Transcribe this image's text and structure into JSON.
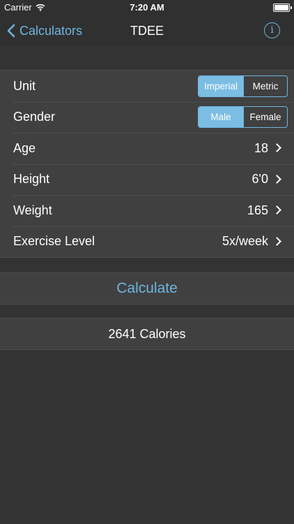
{
  "status_bar": {
    "carrier": "Carrier",
    "time": "7:20 AM"
  },
  "nav": {
    "back_label": "Calculators",
    "title": "TDEE",
    "info_icon": "info-icon"
  },
  "form": {
    "unit": {
      "label": "Unit",
      "options": [
        "Imperial",
        "Metric"
      ],
      "selected": "Imperial"
    },
    "gender": {
      "label": "Gender",
      "options": [
        "Male",
        "Female"
      ],
      "selected": "Male"
    },
    "age": {
      "label": "Age",
      "value": "18"
    },
    "height": {
      "label": "Height",
      "value": "6'0"
    },
    "weight": {
      "label": "Weight",
      "value": "165"
    },
    "exercise": {
      "label": "Exercise Level",
      "value": "5x/week"
    }
  },
  "calculate_label": "Calculate",
  "result": "2641 Calories",
  "colors": {
    "accent": "#6fb5e0",
    "segment_selected": "#7bbde3",
    "background": "#333333",
    "cell": "#404040"
  }
}
